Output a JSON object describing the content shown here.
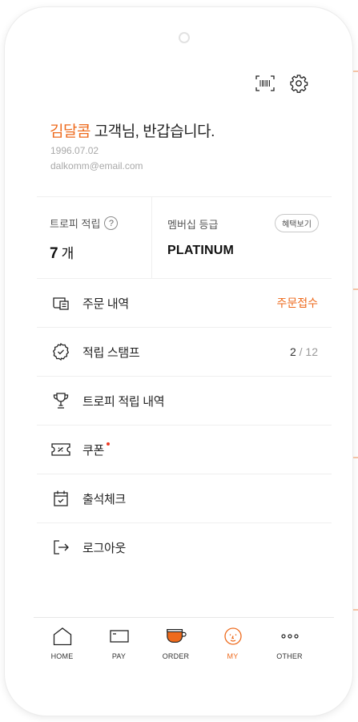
{
  "header": {
    "greeting_name": "김달콤",
    "greeting_suffix": " 고객님, 반갑습니다.",
    "birthdate": "1996.07.02",
    "email": "dalkomm@email.com"
  },
  "stats": {
    "trophy_label": "트로피 적립",
    "trophy_help": "?",
    "trophy_count": "7",
    "trophy_unit": "개",
    "membership_label": "멤버십 등급",
    "benefit_button": "혜택보기",
    "membership_grade": "PLATINUM"
  },
  "menu": {
    "order_history": {
      "label": "주문 내역",
      "status": "주문접수"
    },
    "stamps": {
      "label": "적립 스탬프",
      "current": "2",
      "total": " / 12"
    },
    "trophy_history": {
      "label": "트로피 적립 내역"
    },
    "coupon": {
      "label": "쿠폰"
    },
    "attendance": {
      "label": "출석체크"
    },
    "logout": {
      "label": "로그아웃"
    }
  },
  "nav": {
    "home": "HOME",
    "pay": "PAY",
    "order": "ORDER",
    "my": "MY",
    "other": "OTHER"
  },
  "colors": {
    "accent": "#ee6a1c",
    "notification_dot": "#ee3b24"
  },
  "icons": [
    "barcode-icon",
    "gear-icon",
    "help-icon",
    "receipt-icon",
    "stamp-icon",
    "trophy-icon",
    "ticket-icon",
    "calendar-check-icon",
    "logout-icon",
    "home-icon",
    "card-icon",
    "cup-icon",
    "smile-icon",
    "more-dots-icon"
  ]
}
